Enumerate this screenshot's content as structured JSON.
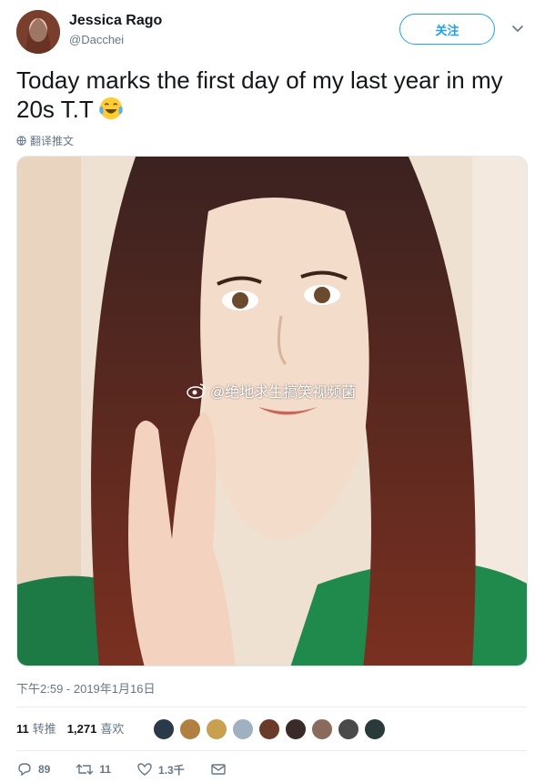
{
  "author": {
    "display_name": "Jessica Rago",
    "handle": "@Dacchei"
  },
  "follow_label": "关注",
  "tweet": {
    "text": "Today marks the first day of my last year in my 20s T.T",
    "emoji": "face-with-tears-of-joy",
    "translate_label": "翻译推文"
  },
  "photo": {
    "watermark": "@绝地求生搞笑视频菌"
  },
  "timestamp": "下午2:59 - 2019年1月16日",
  "stats": {
    "retweets_count": "11",
    "retweets_label": "转推",
    "likes_count": "1,271",
    "likes_label": "喜欢"
  },
  "actions": {
    "reply_count": "89",
    "retweet_count": "11",
    "like_count": "1.3千"
  },
  "colors": {
    "accent": "#1da1f2",
    "muted": "#657786",
    "text": "#14171a"
  }
}
